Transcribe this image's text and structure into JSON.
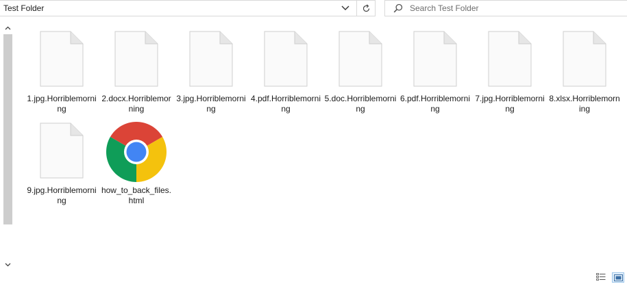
{
  "address_bar": {
    "path": "Test Folder"
  },
  "search": {
    "placeholder": "Search Test Folder"
  },
  "files": [
    {
      "name": "1.jpg.Horriblemorning",
      "type": "blank"
    },
    {
      "name": "2.docx.Horriblemorning",
      "type": "blank"
    },
    {
      "name": "3.jpg.Horriblemorning",
      "type": "blank"
    },
    {
      "name": "4.pdf.Horriblemorning",
      "type": "blank"
    },
    {
      "name": "5.doc.Horriblemorning",
      "type": "blank"
    },
    {
      "name": "6.pdf.Horriblemorning",
      "type": "blank"
    },
    {
      "name": "7.jpg.Horriblemorning",
      "type": "blank"
    },
    {
      "name": "8.xlsx.Horriblemorning",
      "type": "blank"
    },
    {
      "name": "9.jpg.Horriblemorning",
      "type": "blank"
    },
    {
      "name": "how_to_back_files.html",
      "type": "chrome"
    }
  ],
  "icons": {
    "blank_file": "blank-document-icon",
    "html_file": "chrome-icon",
    "chevron": "chevron-down-icon",
    "refresh": "refresh-icon",
    "search": "search-icon",
    "details_view": "details-view-icon",
    "large_icons_view": "large-icons-view-icon"
  },
  "colors": {
    "chrome_red": "#DB4437",
    "chrome_yellow": "#F4C20D",
    "chrome_green": "#0F9D58",
    "chrome_blue": "#4285F4",
    "selected_view": "#E5F1FB"
  }
}
